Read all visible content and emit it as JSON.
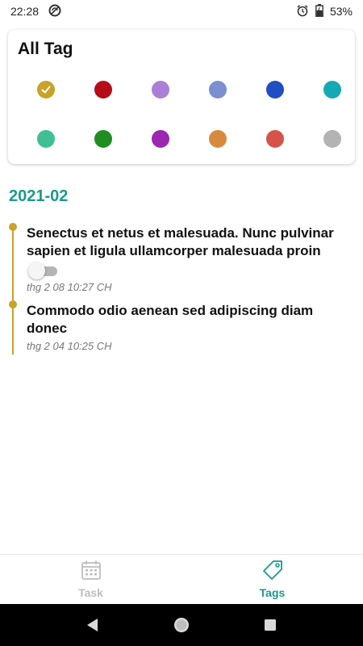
{
  "status_bar": {
    "time": "22:28",
    "battery": "53%"
  },
  "tag_card": {
    "title": "All Tag",
    "selected_index": 0,
    "swatches": [
      {
        "color": "#c9a227"
      },
      {
        "color": "#b50d18"
      },
      {
        "color": "#ab7fd6"
      },
      {
        "color": "#7b8fd1"
      },
      {
        "color": "#1f4fc2"
      },
      {
        "color": "#16a9b4"
      },
      {
        "color": "#3fbf94"
      },
      {
        "color": "#1e8e22"
      },
      {
        "color": "#9c27b0"
      },
      {
        "color": "#d88a3c"
      },
      {
        "color": "#d4544a"
      },
      {
        "color": "#b3b3b3"
      }
    ]
  },
  "timeline": {
    "month": "2021-02",
    "accent_color": "#c9a227",
    "tasks": [
      {
        "title": "Senectus et netus et malesuada. Nunc pulvinar sapien et ligula ullamcorper malesuada proin",
        "date": "thg 2 08 10:27 CH",
        "has_toggle": true,
        "toggle_on": false
      },
      {
        "title": "Commodo odio aenean sed adipiscing diam donec",
        "date": "thg 2 04 10:25 CH",
        "has_toggle": false
      }
    ]
  },
  "bottom_nav": {
    "items": [
      {
        "label": "Task",
        "icon": "calendar-icon",
        "active": false
      },
      {
        "label": "Tags",
        "icon": "tag-icon",
        "active": true
      }
    ],
    "active_color": "#1a9a8a",
    "inactive_color": "#bdbdbd"
  }
}
